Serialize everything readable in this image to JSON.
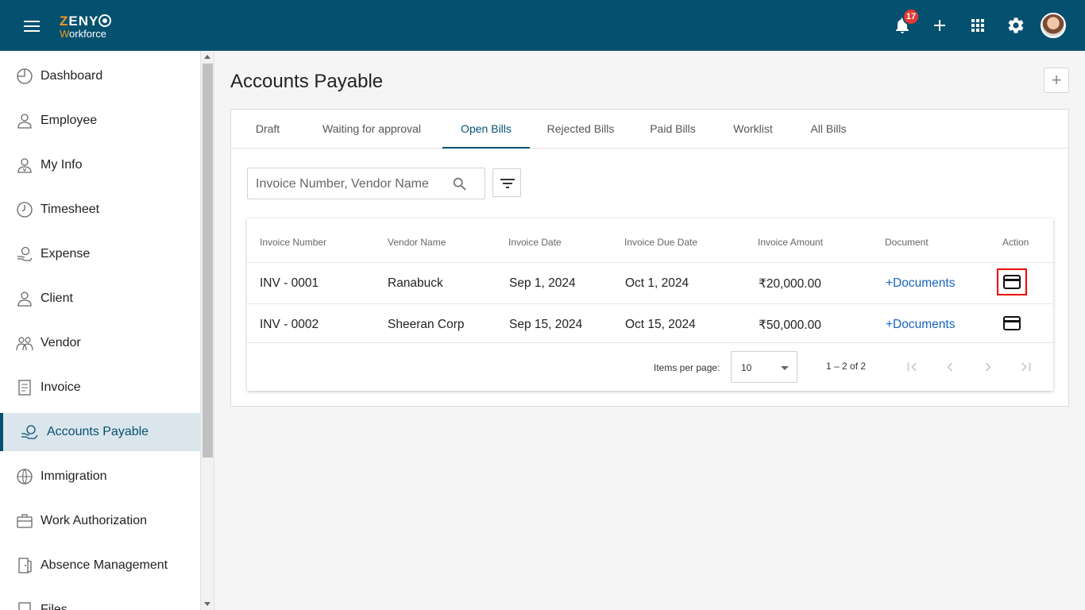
{
  "header": {
    "logo_brand": "ZENY",
    "logo_brand_first": "Z",
    "logo_brand_rest": "ENY",
    "logo_sub_first": "W",
    "logo_sub_rest": "orkforce",
    "notification_count": "17",
    "bar_color": "#04506f"
  },
  "sidebar": {
    "items": [
      {
        "label": "Dashboard",
        "icon": "dashboard-icon"
      },
      {
        "label": "Employee",
        "icon": "employee-icon"
      },
      {
        "label": "My Info",
        "icon": "my-info-icon"
      },
      {
        "label": "Timesheet",
        "icon": "clock-icon"
      },
      {
        "label": "Expense",
        "icon": "expense-icon"
      },
      {
        "label": "Client",
        "icon": "client-icon"
      },
      {
        "label": "Vendor",
        "icon": "vendor-icon"
      },
      {
        "label": "Invoice",
        "icon": "invoice-icon"
      },
      {
        "label": "Accounts Payable",
        "icon": "accounts-payable-icon",
        "active": true
      },
      {
        "label": "Immigration",
        "icon": "globe-icon"
      },
      {
        "label": "Work Authorization",
        "icon": "briefcase-icon"
      },
      {
        "label": "Absence Management",
        "icon": "door-icon"
      },
      {
        "label": "Files",
        "icon": "files-icon"
      }
    ]
  },
  "main": {
    "title": "Accounts Payable",
    "add_symbol": "+",
    "tabs": [
      {
        "label": "Draft"
      },
      {
        "label": "Waiting for approval"
      },
      {
        "label": "Open Bills",
        "active": true
      },
      {
        "label": "Rejected Bills"
      },
      {
        "label": "Paid Bills"
      },
      {
        "label": "Worklist"
      },
      {
        "label": "All Bills"
      }
    ],
    "search_placeholder": "Invoice Number, Vendor Name",
    "table": {
      "columns": [
        "Invoice Number",
        "Vendor Name",
        "Invoice Date",
        "Invoice Due Date",
        "Invoice Amount",
        "Document",
        "Action"
      ],
      "rows": [
        {
          "invoice_number": "INV - 0001",
          "vendor": "Ranabuck",
          "invoice_date": "Sep 1, 2024",
          "due_date": "Oct 1, 2024",
          "amount": "₹20,000.00",
          "document": "+Documents",
          "action_icon": "payment-card-icon"
        },
        {
          "invoice_number": "INV - 0002",
          "vendor": "Sheeran Corp",
          "invoice_date": "Sep 15, 2024",
          "due_date": "Oct 15, 2024",
          "amount": "₹50,000.00",
          "document": "+Documents",
          "action_icon": "payment-card-icon"
        }
      ]
    },
    "pager": {
      "items_per_page_label": "Items per page:",
      "items_per_page_value": "10",
      "range": "1 – 2 of 2"
    }
  }
}
